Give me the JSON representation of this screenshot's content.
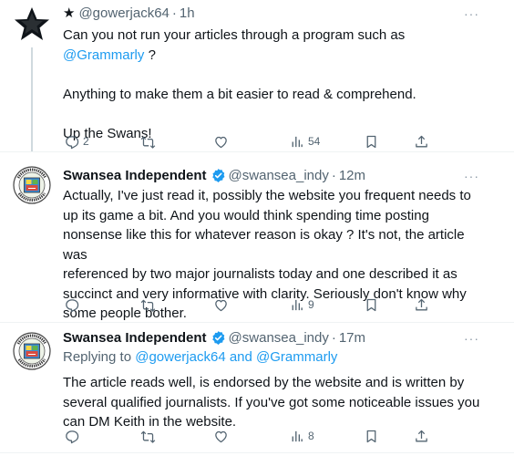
{
  "tweets": [
    {
      "header": {
        "prefix_icon": "star-icon",
        "handle": "@gowerjack64",
        "sep": "·",
        "time": "1h"
      },
      "body": {
        "line1": "Can you not run your articles through a program such as",
        "mention": "@Grammarly",
        "after_mention": " ?",
        "para2": "Anything to make them a bit easier to read & comprehend.",
        "para3": "Up the Swans!"
      },
      "actions": {
        "replies": "2",
        "retweets": "",
        "likes": "",
        "views": "54"
      }
    },
    {
      "header": {
        "name": "Swansea Independent",
        "handle": "@swansea_indy",
        "sep": "·",
        "time": "12m"
      },
      "body": {
        "lines": [
          "Actually, I've just read it, possibly the website you frequent needs to",
          "up its game a bit. And you would think spending time posting",
          "nonsense like this for whatever reason is okay ? It's not, the article was",
          "referenced by two major journalists today and one described it as",
          "succinct and very informative with clarity. Seriously don't know why",
          "some people bother."
        ]
      },
      "actions": {
        "replies": "",
        "retweets": "",
        "likes": "",
        "views": "9"
      }
    },
    {
      "header": {
        "name": "Swansea Independent",
        "handle": "@swansea_indy",
        "sep": "·",
        "time": "17m"
      },
      "replying": {
        "prefix": "Replying to ",
        "users": "@gowerjack64 and @Grammarly"
      },
      "body": {
        "lines": [
          "The article reads well, is endorsed by the website and is written by",
          "several qualified journalists. If you've got some noticeable issues you",
          "can DM Keith in the website."
        ]
      },
      "actions": {
        "replies": "",
        "retweets": "",
        "likes": "",
        "views": "8"
      }
    }
  ],
  "more_label": "···",
  "colors": {
    "text": "#0f1419",
    "muted": "#536471",
    "link": "#1d9bf0",
    "divider": "#eff3f4",
    "verified": "#1d9bf0"
  }
}
